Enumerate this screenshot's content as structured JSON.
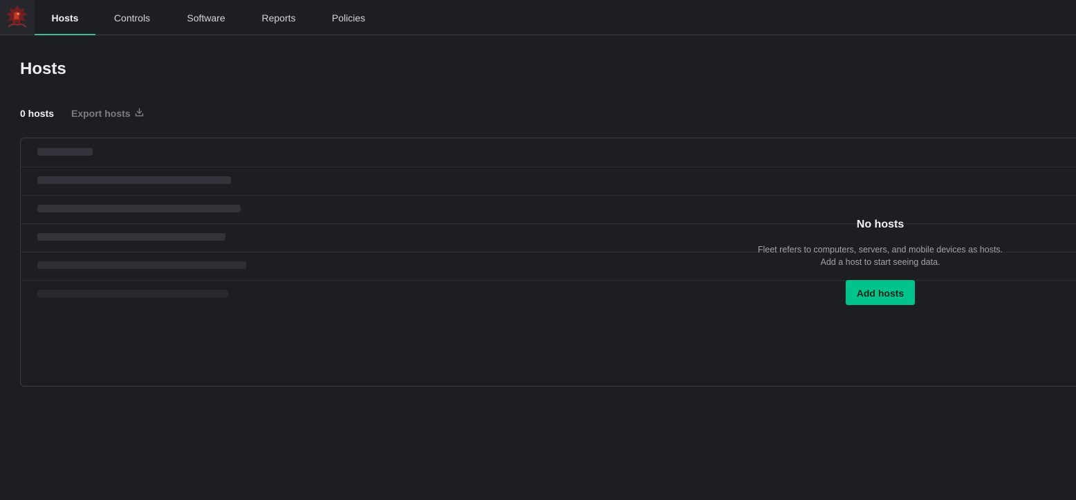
{
  "nav": {
    "tabs": [
      {
        "label": "Hosts",
        "active": true
      },
      {
        "label": "Controls",
        "active": false
      },
      {
        "label": "Software",
        "active": false
      },
      {
        "label": "Reports",
        "active": false
      },
      {
        "label": "Policies",
        "active": false
      }
    ],
    "logo_icon": "dragon-logo-icon"
  },
  "page": {
    "title": "Hosts",
    "host_count": "0 hosts",
    "export_label": "Export hosts",
    "export_icon": "download-icon"
  },
  "table": {
    "skeleton_rows": 6
  },
  "empty_state": {
    "title": "No hosts",
    "line1": "Fleet refers to computers, servers, and mobile devices as hosts.",
    "line2": "Add a host to start seeing data.",
    "button_label": "Add hosts"
  },
  "colors": {
    "accent": "#3fb89b",
    "button": "#00c48c",
    "background": "#1d1e22"
  }
}
